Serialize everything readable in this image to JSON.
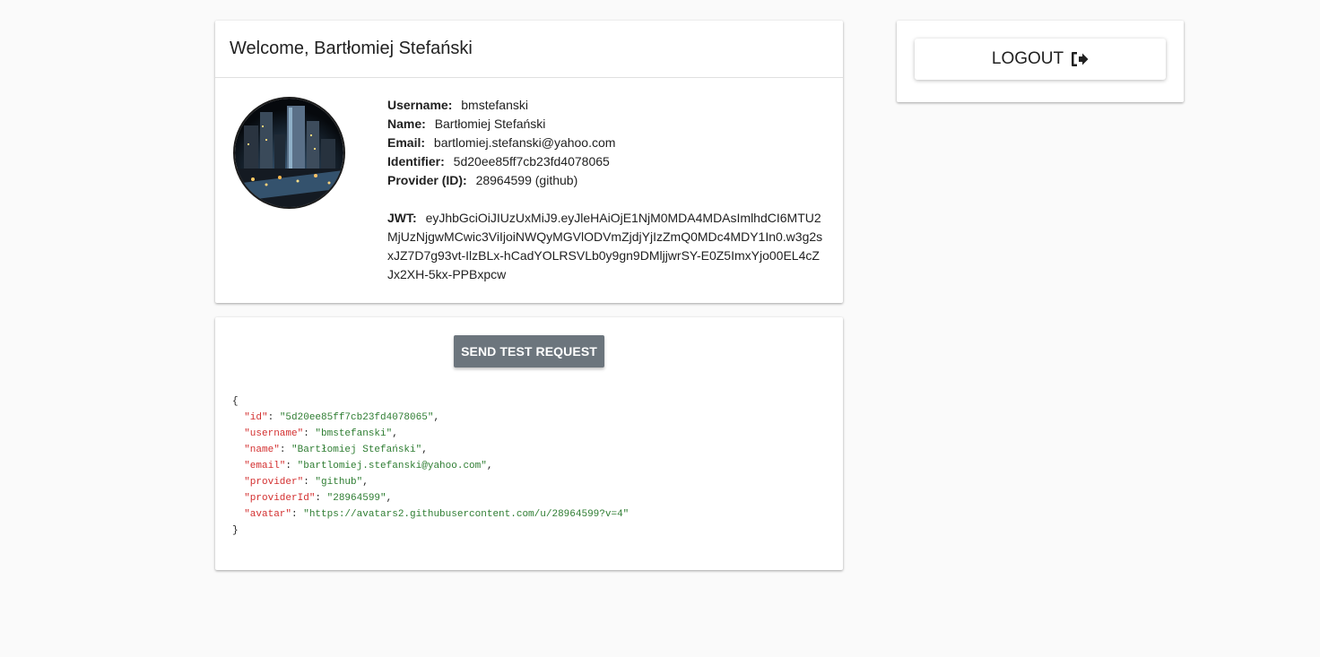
{
  "profile": {
    "welcome": "Welcome, Bartłomiej Stefański",
    "fields": [
      {
        "label": "Username:",
        "value": "bmstefanski"
      },
      {
        "label": "Name:",
        "value": "Bartłomiej Stefański"
      },
      {
        "label": "Email:",
        "value": "bartlomiej.stefanski@yahoo.com"
      },
      {
        "label": "Identifier:",
        "value": "5d20ee85ff7cb23fd4078065"
      },
      {
        "label": "Provider (ID):",
        "value": "28964599 (github)"
      }
    ],
    "jwt": {
      "label": "JWT:",
      "value": "eyJhbGciOiJIUzUxMiJ9.eyJleHAiOjE1NjM0MDA4MDAsImlhdCI6MTU2MjUzNjgwMCwic3ViIjoiNWQyMGVlODVmZjdjYjIzZmQ0MDc4MDY1In0.w3g2sxJZ7D7g93vt-IlzBLx-hCadYOLRSVLb0y9gn9DMljjwrSY-E0Z5ImxYjo00EL4cZJx2XH-5kx-PPBxpcw"
    },
    "avatar_icon": "user-avatar-photo"
  },
  "request": {
    "send_button": "SEND TEST REQUEST",
    "response": {
      "open": "{",
      "close": "}",
      "entries": [
        {
          "key": "\"id\"",
          "value": "\"5d20ee85ff7cb23fd4078065\"",
          "sep": ","
        },
        {
          "key": "\"username\"",
          "value": "\"bmstefanski\"",
          "sep": ","
        },
        {
          "key": "\"name\"",
          "value": "\"Bartłomiej Stefański\"",
          "sep": ","
        },
        {
          "key": "\"email\"",
          "value": "\"bartlomiej.stefanski@yahoo.com\"",
          "sep": ","
        },
        {
          "key": "\"provider\"",
          "value": "\"github\"",
          "sep": ","
        },
        {
          "key": "\"providerId\"",
          "value": "\"28964599\"",
          "sep": ","
        },
        {
          "key": "\"avatar\"",
          "value": "\"https://avatars2.githubusercontent.com/u/28964599?v=4\"",
          "sep": ""
        }
      ]
    }
  },
  "logout": {
    "label": "LOGOUT",
    "icon": "sign-out-icon"
  },
  "colors": {
    "background": "#fafafa",
    "card": "#ffffff",
    "send_button_bg": "#6c757d",
    "json_key": "#d32f2f",
    "json_value": "#2e7d32"
  }
}
